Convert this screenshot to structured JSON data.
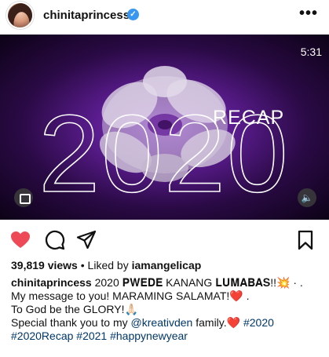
{
  "header": {
    "username": "chinitaprincess",
    "verified_icon": "check-icon",
    "more_label": "•••"
  },
  "video": {
    "duration": "5:31",
    "big_text": "2020",
    "recap_label": "RECAP",
    "mute_label": "🔈",
    "colors": {
      "bg_center": "#8a3cc8",
      "bg_edge": "#0c0216"
    }
  },
  "actions": {
    "icons": [
      "heart-icon",
      "comment-icon",
      "share-icon",
      "bookmark-icon"
    ],
    "heart_color": "#ed4956"
  },
  "stats": {
    "views": "39,819 views",
    "separator": "•",
    "liked_prefix": "Liked by",
    "liked_user": "iamangelicap"
  },
  "caption": {
    "user": "chinitaprincess",
    "line1_text": " 2020 𝐏𝐖𝐄𝐃𝐄 KANANG 𝐋𝐔𝐌𝐀𝐁𝐀𝐒!!💥 · .",
    "line2": "My message to you! MARAMING SALAMAT!❤️ .",
    "line3": "To God be the GLORY!🙏🏻",
    "line4_prefix": "Special thank you to my ",
    "mention": "@kreativden",
    "line4_suffix": " family.❤️ ",
    "tags_line4": "#2020",
    "tags_line5": "#2020Recap #2021 #happynewyear",
    "tag_color": "#00376b"
  }
}
